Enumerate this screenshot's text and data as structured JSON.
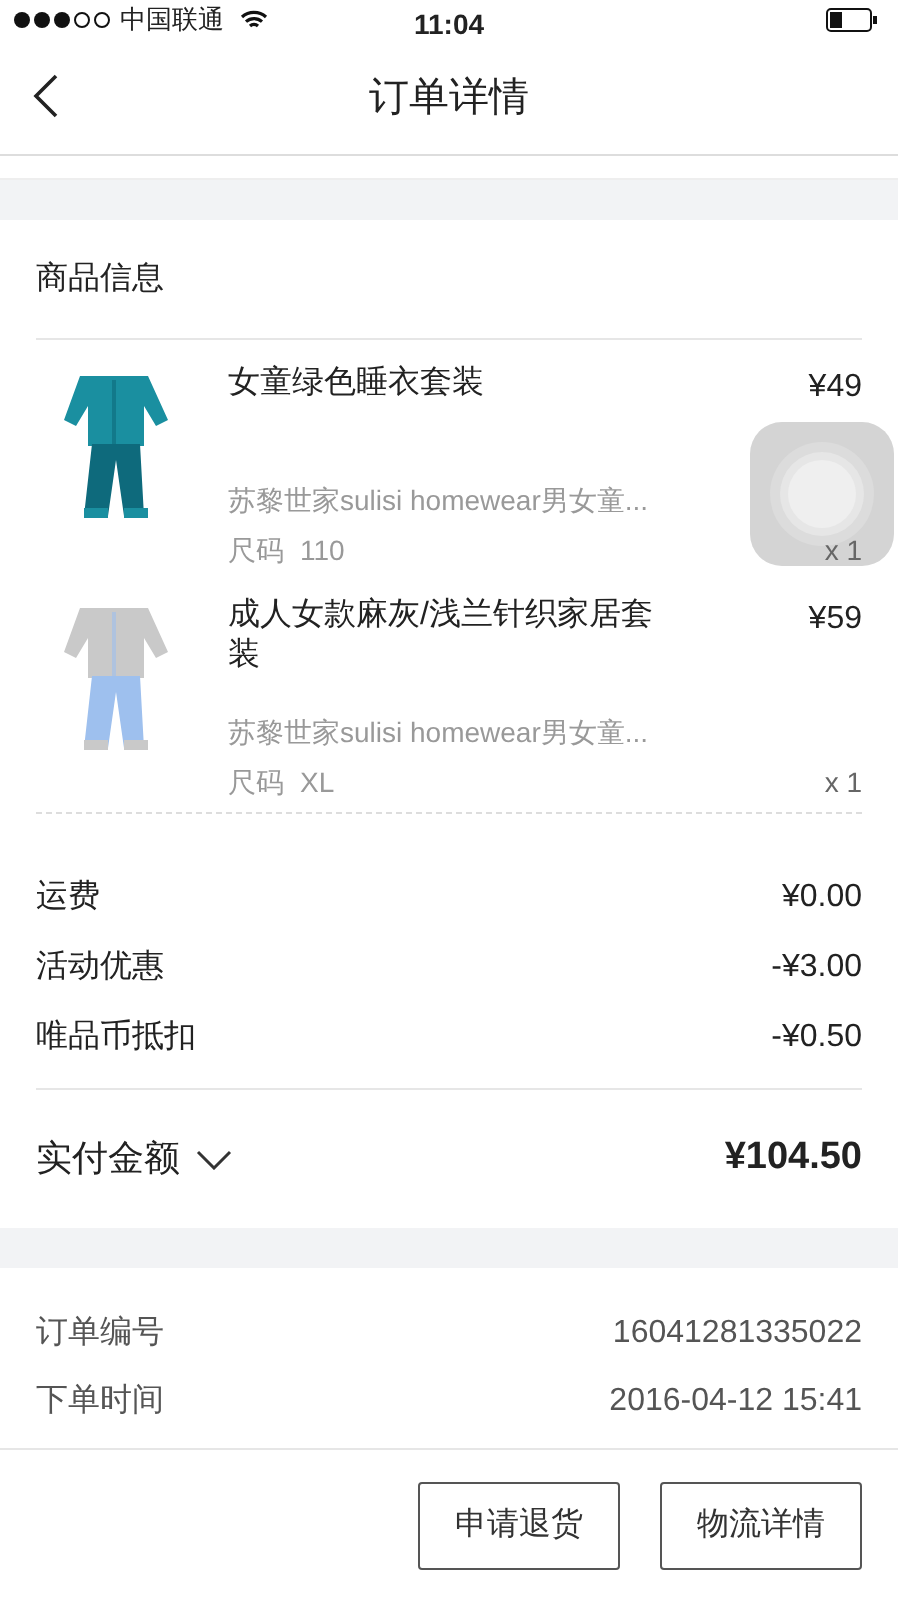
{
  "status_bar": {
    "carrier": "中国联通",
    "time": "11:04"
  },
  "nav": {
    "title": "订单详情"
  },
  "goods": {
    "heading": "商品信息",
    "items": [
      {
        "name": "女童绿色睡衣套装",
        "price": "¥49",
        "desc": "苏黎世家sulisi homewear男女童...",
        "size_label": "尺码",
        "size": "110",
        "quantity": "x 1"
      },
      {
        "name": "成人女款麻灰/浅兰针织家居套装",
        "price": "¥59",
        "desc": "苏黎世家sulisi homewear男女童...",
        "size_label": "尺码",
        "size": "XL",
        "quantity": "x 1"
      }
    ]
  },
  "fees": [
    {
      "label": "运费",
      "value": "¥0.00"
    },
    {
      "label": "活动优惠",
      "value": "-¥3.00"
    },
    {
      "label": "唯品币抵扣",
      "value": "-¥0.50"
    }
  ],
  "total": {
    "label": "实付金额",
    "amount": "¥104.50",
    "expanded": false
  },
  "order_info": [
    {
      "label": "订单编号",
      "value": "16041281335022"
    },
    {
      "label": "下单时间",
      "value": "2016-04-12 15:41"
    }
  ],
  "buttons": [
    "申请退货",
    "物流详情"
  ]
}
